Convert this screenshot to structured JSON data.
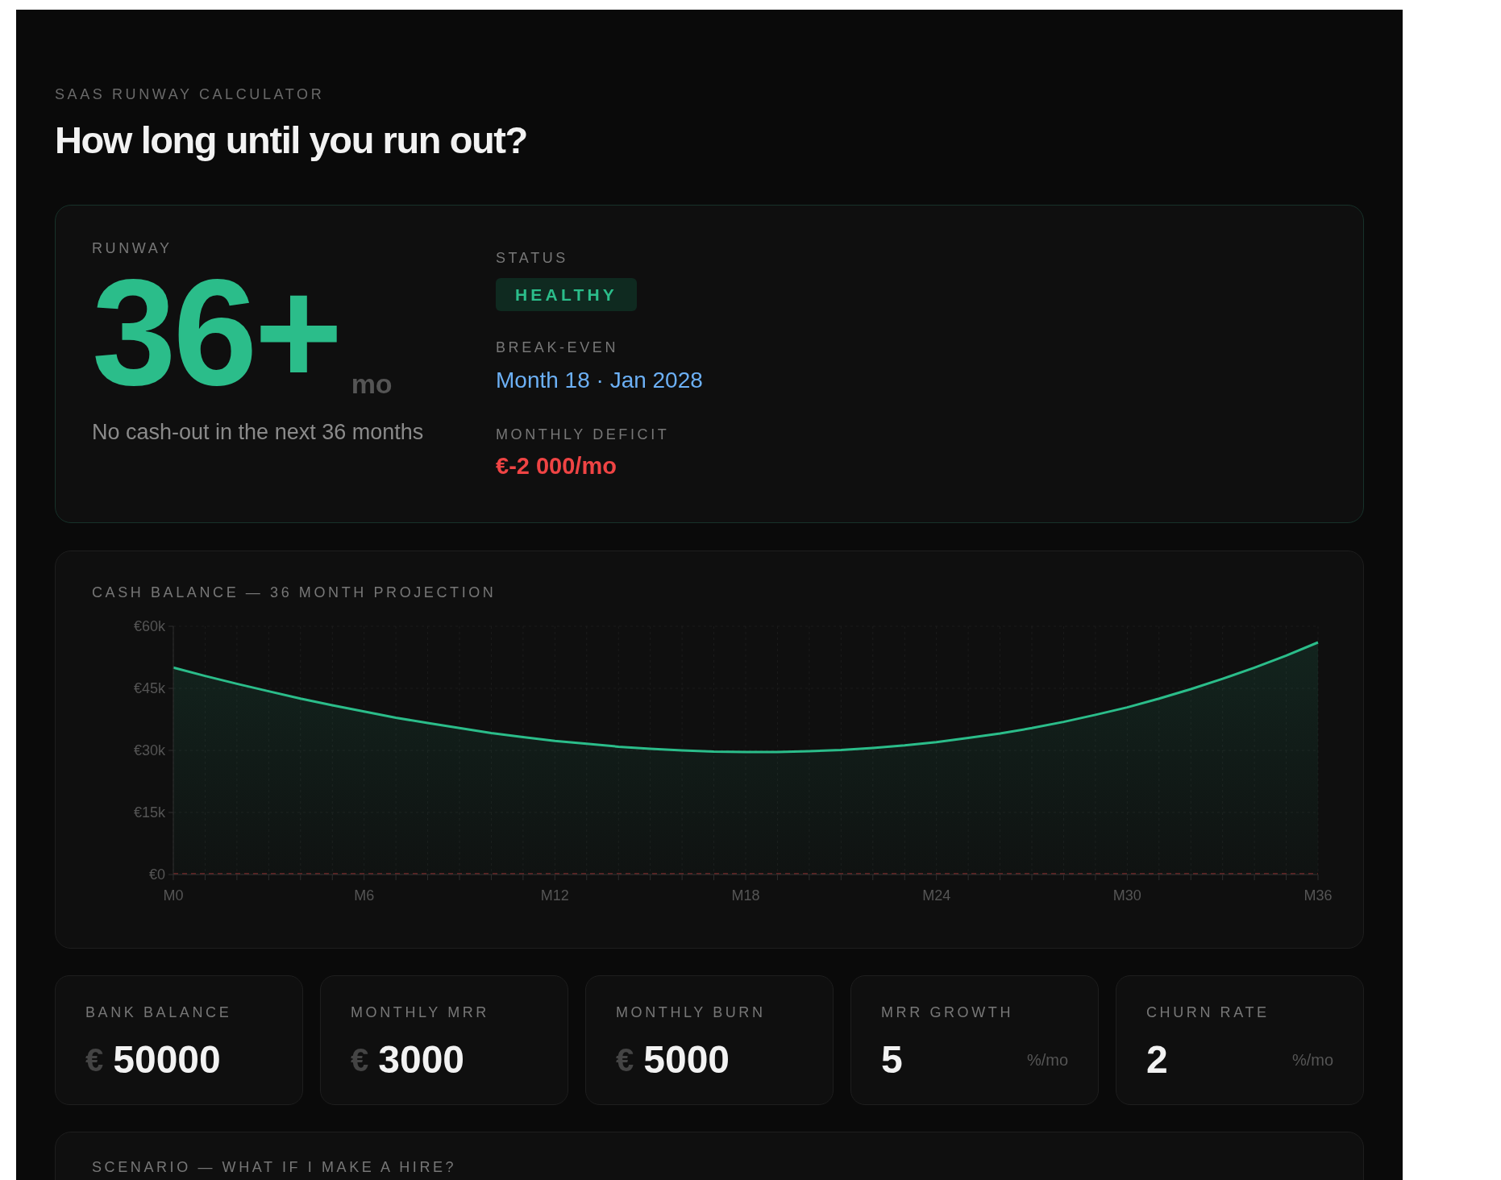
{
  "header": {
    "eyebrow": "SAAS RUNWAY CALCULATOR",
    "title": "How long until you run out?"
  },
  "runway": {
    "label": "RUNWAY",
    "value": "36+",
    "unit": "mo",
    "note": "No cash-out in the next 36 months"
  },
  "status": {
    "label": "STATUS",
    "badge": "HEALTHY",
    "kind": "healthy"
  },
  "break_even": {
    "label": "BREAK-EVEN",
    "value": "Month 18 · Jan 2028"
  },
  "monthly_deficit": {
    "label": "MONTHLY DEFICIT",
    "value": "€-2 000/mo"
  },
  "chart": {
    "chart_data": {
      "type": "area",
      "title": "CASH BALANCE — 36 MONTH PROJECTION",
      "categories": [
        "M0",
        null,
        null,
        null,
        null,
        null,
        "M6",
        null,
        null,
        null,
        null,
        null,
        "M12",
        null,
        null,
        null,
        null,
        null,
        "M18",
        null,
        null,
        null,
        null,
        null,
        "M24",
        null,
        null,
        null,
        null,
        null,
        "M30",
        null,
        null,
        null,
        null,
        null,
        "M36"
      ],
      "ylim": [
        0,
        60000
      ],
      "grid": true,
      "yticks": [
        {
          "value": 0,
          "label": "€0"
        },
        {
          "value": 15000,
          "label": "€15k"
        },
        {
          "value": 30000,
          "label": "€30k"
        },
        {
          "value": 45000,
          "label": "€45k"
        },
        {
          "value": 60000,
          "label": "€60k"
        }
      ],
      "series": [
        {
          "color": "#2bbd8a",
          "values": [
            50000,
            48000,
            46100,
            44300,
            42500,
            40900,
            39400,
            37900,
            36600,
            35400,
            34200,
            33200,
            32300,
            31600,
            30900,
            30400,
            30000,
            29700,
            29600,
            29600,
            29800,
            30100,
            30600,
            31200,
            32000,
            33000,
            34100,
            35400,
            36900,
            38600,
            40400,
            42500,
            44800,
            47300,
            50000,
            52900,
            56100
          ]
        }
      ]
    }
  },
  "inputs": [
    {
      "label": "BANK BALANCE",
      "prefix": "€",
      "value": "50000"
    },
    {
      "label": "MONTHLY MRR",
      "prefix": "€",
      "value": "3000"
    },
    {
      "label": "MONTHLY BURN",
      "prefix": "€",
      "value": "5000"
    },
    {
      "label": "MRR GROWTH",
      "value": "5",
      "suffix": "%/mo"
    },
    {
      "label": "CHURN RATE",
      "value": "2",
      "suffix": "%/mo"
    }
  ],
  "scenario": {
    "title": "SCENARIO — WHAT IF I MAKE A HIRE?"
  }
}
